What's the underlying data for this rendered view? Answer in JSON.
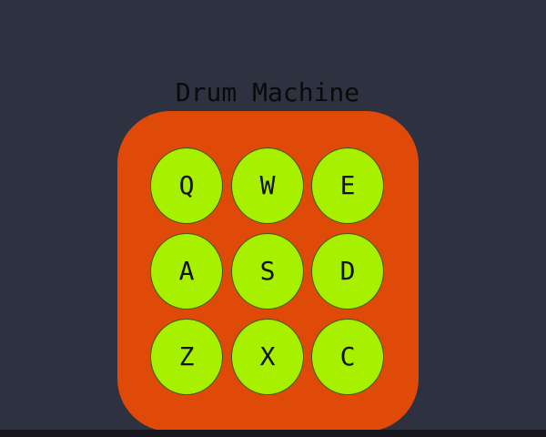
{
  "app": {
    "title": "Drum Machine"
  },
  "colors": {
    "background": "#2d3140",
    "machine": "#e04a08",
    "pad": "#a6f000",
    "text": "#0a0a0a"
  },
  "pads": [
    {
      "key": "Q"
    },
    {
      "key": "W"
    },
    {
      "key": "E"
    },
    {
      "key": "A"
    },
    {
      "key": "S"
    },
    {
      "key": "D"
    },
    {
      "key": "Z"
    },
    {
      "key": "X"
    },
    {
      "key": "C"
    }
  ]
}
